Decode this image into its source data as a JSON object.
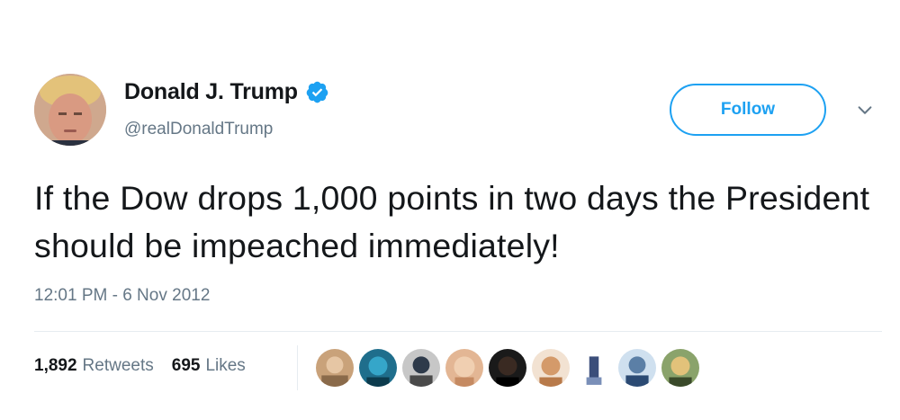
{
  "author": {
    "display_name": "Donald J. Trump",
    "handle": "@realDonaldTrump",
    "verified": true
  },
  "follow_button": {
    "label": "Follow"
  },
  "tweet": {
    "text": "If the Dow drops 1,000 points in two days the President should be impeached immediately!",
    "timestamp": "12:01 PM - 6 Nov 2012"
  },
  "stats": {
    "retweets_count": "1,892",
    "retweets_label": "Retweets",
    "likes_count": "695",
    "likes_label": "Likes"
  },
  "icons": {
    "verified": "verified-badge-icon",
    "more": "chevron-down-icon"
  },
  "colors": {
    "accent": "#1da1f2",
    "text": "#14171a",
    "muted": "#657786"
  }
}
